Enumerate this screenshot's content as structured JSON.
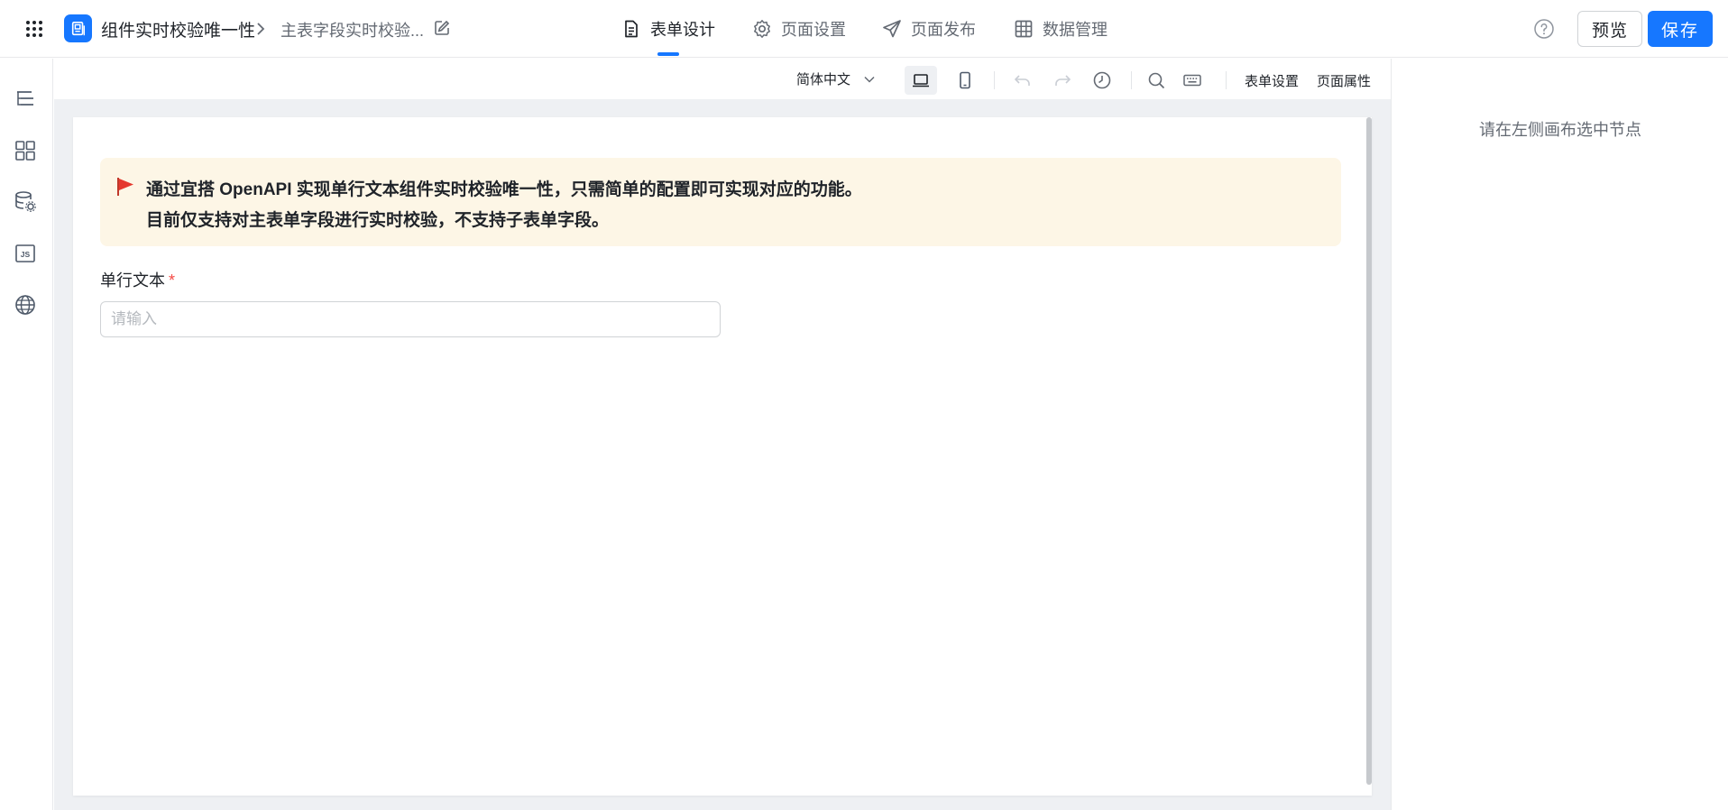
{
  "header": {
    "app_name": "组件实时校验唯一性",
    "page_name": "主表字段实时校验...",
    "tabs": [
      {
        "label": "表单设计",
        "icon": "document-icon",
        "active": true
      },
      {
        "label": "页面设置",
        "icon": "gear-icon",
        "active": false
      },
      {
        "label": "页面发布",
        "icon": "paper-plane-icon",
        "active": false
      },
      {
        "label": "数据管理",
        "icon": "table-icon",
        "active": false
      }
    ],
    "preview_label": "预览",
    "save_label": "保存"
  },
  "left_rail": {
    "items": [
      "outline-tree-icon",
      "components-grid-icon",
      "data-source-icon",
      "js-code-icon",
      "globe-icon"
    ]
  },
  "toolbar": {
    "language": "简体中文",
    "form_settings_label": "表单设置",
    "page_properties_label": "页面属性"
  },
  "canvas": {
    "notice": {
      "line1": "通过宜搭 OpenAPI 实现单行文本组件实时校验唯一性，只需简单的配置即可实现对应的功能。",
      "line2": "目前仅支持对主表单字段进行实时校验，不支持子表单字段。"
    },
    "field": {
      "label": "单行文本",
      "required_mark": "*",
      "placeholder": "请输入"
    }
  },
  "right_panel": {
    "hint": "请在左侧画布选中节点"
  },
  "colors": {
    "accent": "#1677ff",
    "notice_bg": "#fdf6e6",
    "required": "#f54a45",
    "canvas_bg": "#eef0f3"
  }
}
